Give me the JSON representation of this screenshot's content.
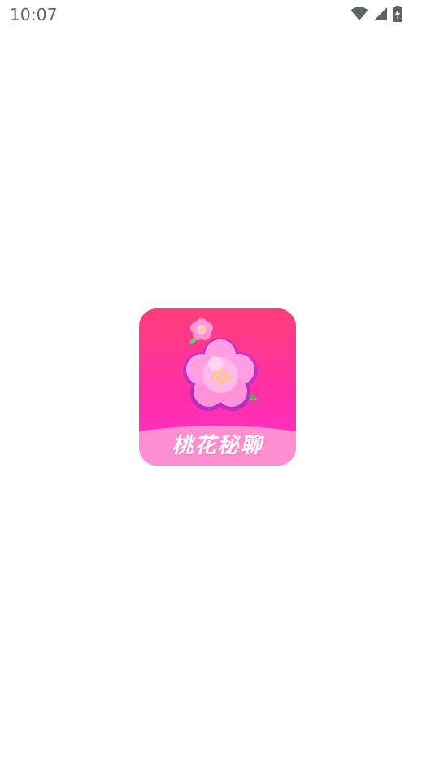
{
  "status_bar": {
    "time": "10:07",
    "icons": [
      "wifi-icon",
      "cellular-signal-icon",
      "battery-charging-icon"
    ],
    "icon_color": "#5f6368"
  },
  "splash": {
    "logo": {
      "text": "桃花秘聊",
      "icon": "peach-blossom-icon",
      "gradient_top": "#ff3d7a",
      "gradient_bottom": "#ff2fd0",
      "band_color": "#ff8fd0"
    }
  },
  "background_color": "#ffffff"
}
